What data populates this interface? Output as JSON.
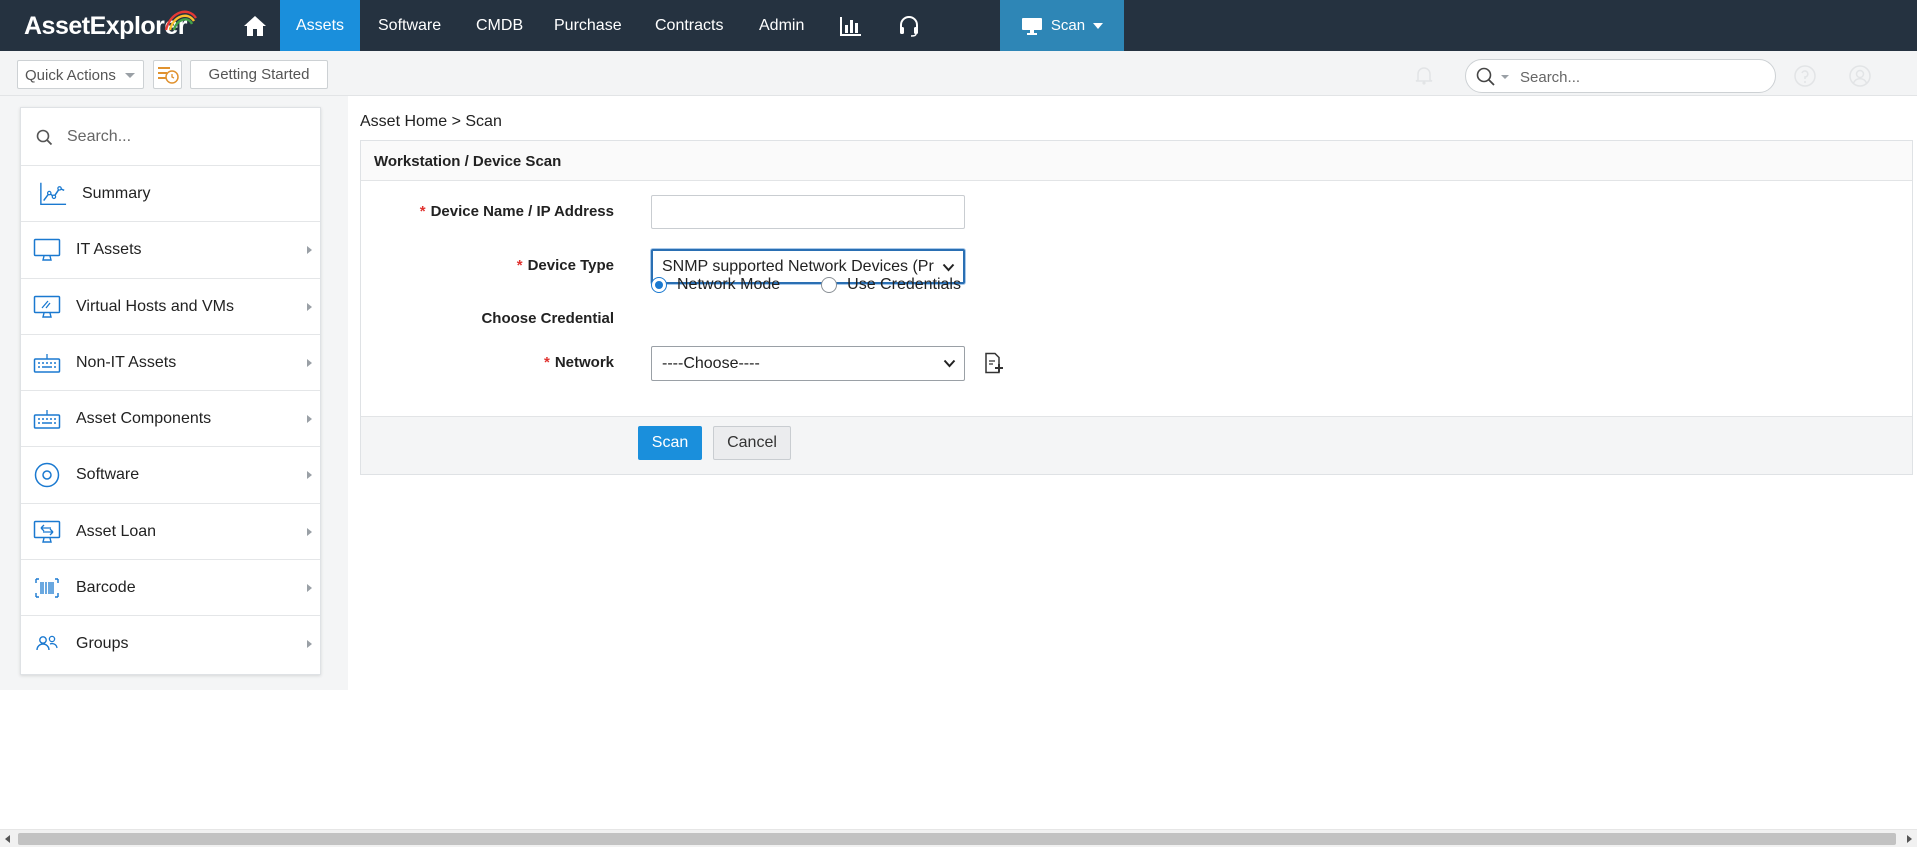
{
  "brand": {
    "name": "AssetExplorer"
  },
  "nav": {
    "items": [
      {
        "label": "Assets",
        "active": true
      },
      {
        "label": "Software",
        "active": false
      },
      {
        "label": "CMDB",
        "active": false
      },
      {
        "label": "Purchase",
        "active": false
      },
      {
        "label": "Contracts",
        "active": false
      },
      {
        "label": "Admin",
        "active": false
      }
    ],
    "icons": [
      "home-icon",
      "reports-icon",
      "support-headset-icon"
    ],
    "scan_button": {
      "label": "Scan",
      "icon": "monitor-icon"
    }
  },
  "subbar": {
    "quick_actions": "Quick Actions",
    "getting_started": "Getting Started",
    "search_placeholder": "Search..."
  },
  "sidebar": {
    "search_placeholder": "Search...",
    "items": [
      {
        "label": "Summary",
        "icon": "chart-line-icon",
        "has_submenu": false
      },
      {
        "label": "IT Assets",
        "icon": "monitor-icon",
        "has_submenu": true
      },
      {
        "label": "Virtual Hosts and VMs",
        "icon": "virtual-monitor-icon",
        "has_submenu": true
      },
      {
        "label": "Non-IT Assets",
        "icon": "keyboard-icon",
        "has_submenu": true
      },
      {
        "label": "Asset Components",
        "icon": "keyboard-icon",
        "has_submenu": true
      },
      {
        "label": "Software",
        "icon": "disc-icon",
        "has_submenu": true
      },
      {
        "label": "Asset Loan",
        "icon": "asset-loan-icon",
        "has_submenu": true
      },
      {
        "label": "Barcode",
        "icon": "barcode-icon",
        "has_submenu": true
      },
      {
        "label": "Groups",
        "icon": "users-icon",
        "has_submenu": true
      }
    ]
  },
  "breadcrumb": "Asset Home > Scan",
  "form": {
    "title": "Workstation / Device Scan",
    "required_mark": "*",
    "device_name_label": "Device Name / IP Address",
    "device_name_value": "",
    "device_type_label": "Device Type",
    "device_type_value": "SNMP supported Network Devices (Pr",
    "credential_label": "Choose Credential",
    "credential_options": [
      {
        "label": "Network Mode",
        "checked": true
      },
      {
        "label": "Use Credentials",
        "checked": false
      }
    ],
    "network_label": "Network",
    "network_value": "----Choose----",
    "scan_button": "Scan",
    "cancel_button": "Cancel"
  },
  "colors": {
    "topbar": "#253240",
    "accent": "#1a8fdc",
    "scan_tab": "#2e86b6",
    "required": "#e0322f"
  }
}
